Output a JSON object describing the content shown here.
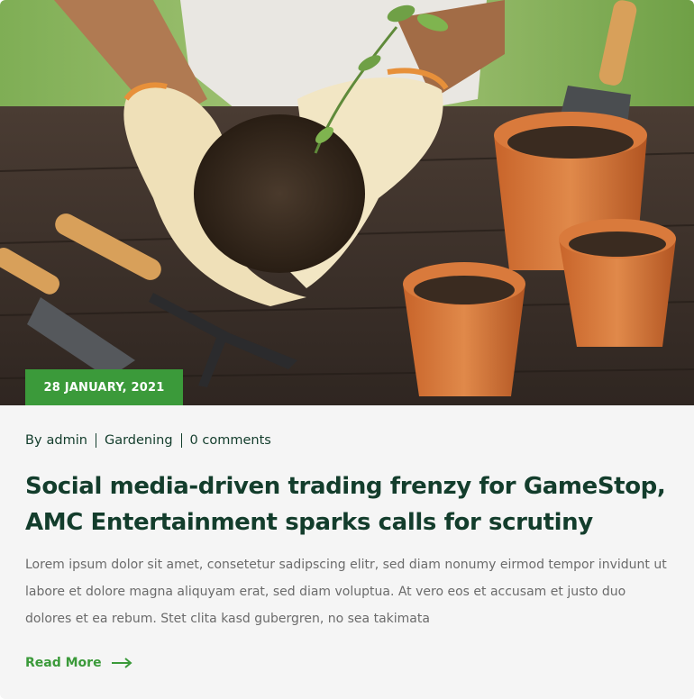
{
  "post": {
    "date": "28 JANUARY, 2021",
    "author_prefix": "By",
    "author": "admin",
    "category": "Gardening",
    "comments": "0 comments",
    "title": "Social media-driven trading frenzy for GameStop, AMC Entertainment sparks calls for scrutiny",
    "excerpt": "Lorem ipsum dolor sit amet, consetetur sadipscing elitr, sed diam nonumy eirmod tempor invidunt ut labore et dolore magna aliquyam erat, sed diam voluptua. At vero eos et accusam et justo duo dolores et ea rebum. Stet clita kasd gubergren, no sea takimata",
    "read_more": "Read More"
  },
  "image": {
    "subject": "gloved hands holding a seedling in soil, terracotta pots and garden tools on a wooden table"
  },
  "colors": {
    "accent": "#3b9a3a",
    "heading": "#133d2c",
    "body_text": "#6b6b6b",
    "card_bg": "#f5f5f5"
  },
  "icons": {
    "read_more": "arrow-right-icon"
  }
}
